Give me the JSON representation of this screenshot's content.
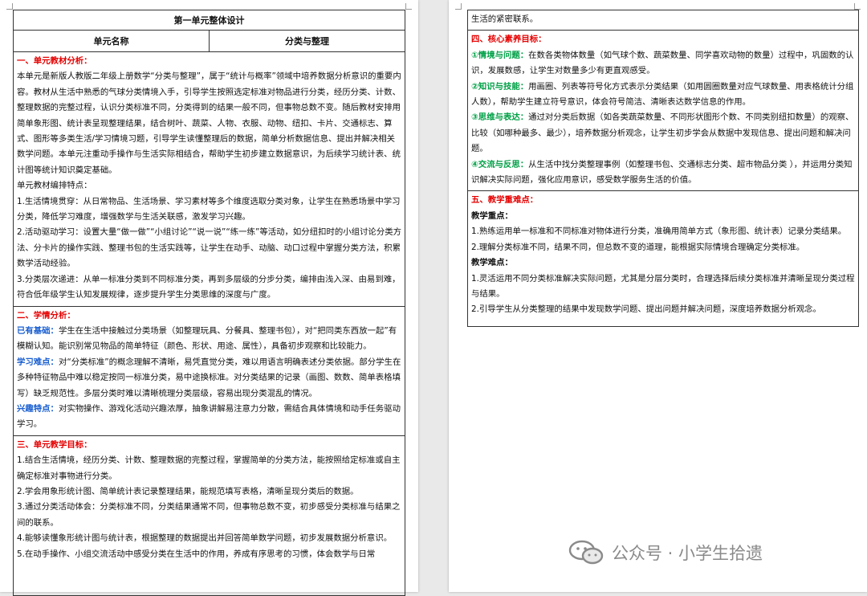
{
  "left": {
    "title": "第一单元整体设计",
    "head": {
      "col1": "单元名称",
      "col2": "分类与整理"
    },
    "sec1": {
      "title": "一、单元教材分析：",
      "p1": "本单元是新版人教版二年级上册数学“分类与整理”，属于“统计与概率”领域中培养数据分析意识的重要内容。教材从生活中熟悉的气球分类情境入手，引导学生按照选定标准对物品进行分类，经历分类、计数、整理数据的完整过程，认识分类标准不同，分类得到的结果一般不同，但事物总数不变。随后教材安排用简单象形图、统计表呈现整理结果，结合树叶、蔬菜、人物、衣服、动物、纽扣、卡片、交通标志、算式、图形等多类生活/学习情境习题，引导学生读懂整理后的数据，简单分析数据信息、提出并解决相关数学问题。本单元注重动手操作与生活实际相结合，帮助学生初步建立数据意识，为后续学习统计表、统计图等统计知识奠定基础。",
      "p2": "单元教材编排特点：",
      "p3": "1.生活情境贯穿：从日常物品、生活场景、学习素材等多个维度选取分类对象，让学生在熟悉场景中学习分类，降低学习难度，增强数学与生活关联感，激发学习兴趣。",
      "p4": "2.活动驱动学习：设置大量“做一做”“小组讨论”“说一说”“练一练”等活动，如分纽扣时的小组讨论分类方法、分卡片的操作实践、整理书包的生活实践等，让学生在动手、动脑、动口过程中掌握分类方法，积累数学活动经验。",
      "p5": "3.分类层次递进：从单一标准分类到不同标准分类，再到多层级的分步分类，编排由浅入深、由易到难，符合低年级学生认知发展规律，逐步提升学生分类思维的深度与广度。"
    },
    "sec2": {
      "title": "二、学情分析：",
      "k1": "已有基础：",
      "t1": "学生在生活中接触过分类场景（如整理玩具、分餐具、整理书包），对“把同类东西放一起”有模糊认知。能识别常见物品的简单特征（颜色、形状、用途、属性），具备初步观察和比较能力。",
      "k2": "学习难点：",
      "t2": "对“分类标准”的概念理解不清晰，易凭直觉分类，难以用语言明确表述分类依据。部分学生在多种特征物品中难以稳定按同一标准分类，易中途换标准。对分类结果的记录（画图、数数、简单表格填写）缺乏规范性。多层分类时难以清晰梳理分类层级，容易出现分类混乱的情况。",
      "k3": "兴趣特点：",
      "t3": "对实物操作、游戏化活动兴趣浓厚，抽象讲解易注意力分散，需结合具体情境和动手任务驱动学习。"
    },
    "sec3": {
      "title": "三、单元教学目标：",
      "p1": "1.结合生活情境，经历分类、计数、整理数据的完整过程，掌握简单的分类方法，能按照给定标准或自主确定标准对事物进行分类。",
      "p2": "2.学会用象形统计图、简单统计表记录整理结果，能规范填写表格，清晰呈现分类后的数据。",
      "p3": "3.通过分类活动体会：分类标准不同，分类结果通常不同，但事物总数不变，初步感受分类标准与结果之间的联系。",
      "p4": "4.能够读懂象形统计图与统计表，根据整理的数据提出并回答简单数学问题，初步发展数据分析意识。",
      "p5": "5.在动手操作、小组交流活动中感受分类在生活中的作用，养成有序思考的习惯，体会数学与日常"
    }
  },
  "right": {
    "cont": "生活的紧密联系。",
    "sec4": {
      "title": "四、核心素养目标：",
      "k1": "①情境与问题：",
      "t1": "在数各类物体数量（如气球个数、蔬菜数量、同学喜欢动物的数量）过程中，巩固数的认识，发展数感，让学生对数量多少有更直观感受。",
      "k2": "②知识与技能：",
      "t2": "用画圈、列表等符号化方式表示分类结果（如用圆圈数量对应气球数量、用表格统计分组人数），帮助学生建立符号意识，体会符号简洁、清晰表达数学信息的作用。",
      "k3": "③思维与表达：",
      "t3": "通过对分类后数据（如各类蔬菜数量、不同形状图形个数、不同类别纽扣数量）的观察、比较（如哪种最多、最少），培养数据分析观念，让学生初步学会从数据中发现信息、提出问题和解决问题。",
      "k4": "④交流与反思：",
      "t4": "从生活中找分类整理事例（如整理书包、交通标志分类、超市物品分类 ），并运用分类知识解决实际问题，强化应用意识，感受数学服务生活的价值。"
    },
    "sec5": {
      "title": "五、教学重难点：",
      "h1": "教学重点：",
      "p1": "1.熟练运用单一标准和不同标准对物体进行分类，准确用简单方式（象形图、统计表）记录分类结果。",
      "p2": "2.理解分类标准不同，结果不同，但总数不变的道理，能根据实际情境合理确定分类标准。",
      "h2": "教学难点：",
      "p3": "1.灵活运用不同分类标准解决实际问题，尤其是分层分类时，合理选择后续分类标准并清晰呈现分类过程与结果。",
      "p4": "2.引导学生从分类整理的结果中发现数学问题、提出问题并解决问题，深度培养数据分析观念。"
    }
  },
  "watermark": {
    "text": "公众号 · 小学生拾遗",
    "icon": "wechat-icon"
  }
}
